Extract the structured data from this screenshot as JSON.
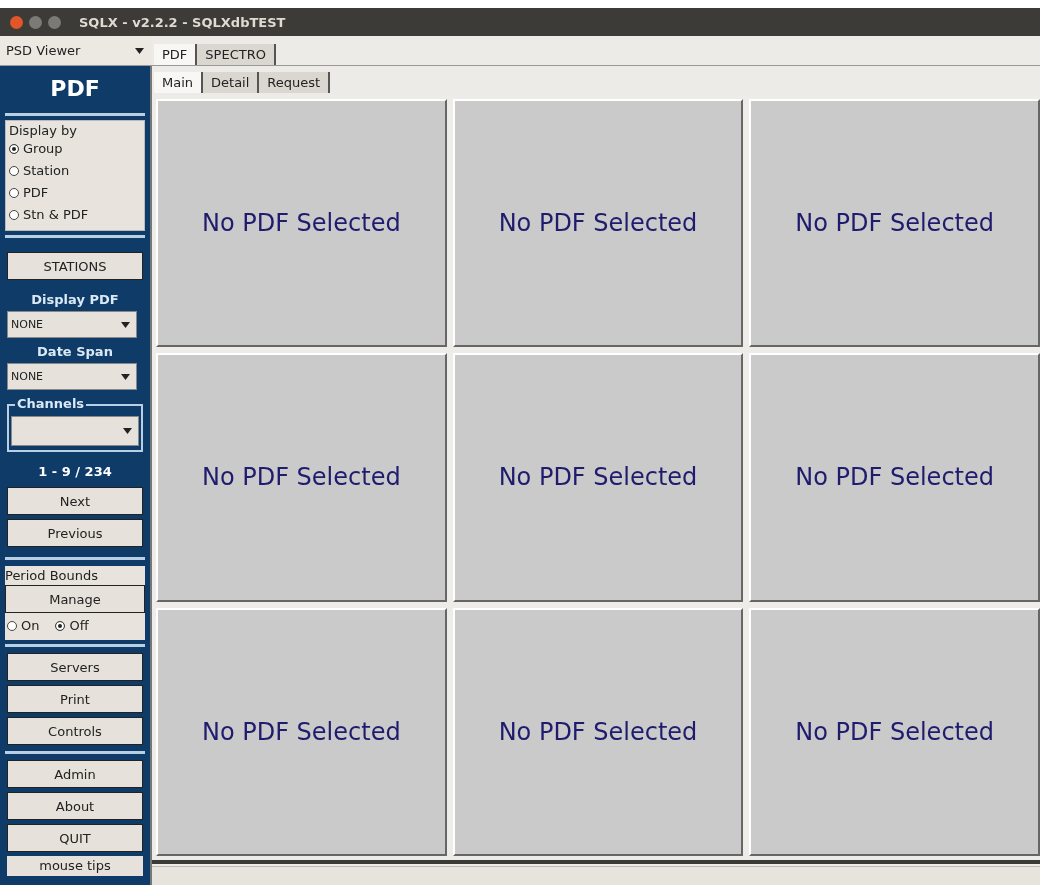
{
  "window": {
    "title": "SQLX - v2.2.2 - SQLXdbTEST"
  },
  "viewer_select": {
    "value": "PSD Viewer"
  },
  "tabs": [
    {
      "label": "PDF",
      "selected": true
    },
    {
      "label": "SPECTRO",
      "selected": false
    }
  ],
  "subtabs": [
    {
      "label": "Main",
      "selected": true
    },
    {
      "label": "Detail",
      "selected": false
    },
    {
      "label": "Request",
      "selected": false
    }
  ],
  "sidebar": {
    "heading": "PDF",
    "display_by": {
      "title": "Display by",
      "options": [
        {
          "label": "Group",
          "selected": true
        },
        {
          "label": "Station",
          "selected": false
        },
        {
          "label": "PDF",
          "selected": false
        },
        {
          "label": "Stn & PDF",
          "selected": false
        }
      ]
    },
    "stations_button": "STATIONS",
    "display_pdf": {
      "label": "Display PDF",
      "value": "NONE"
    },
    "date_span": {
      "label": "Date Span",
      "value": "NONE"
    },
    "channels": {
      "title": "Channels"
    },
    "page_range": "1 - 9 / 234",
    "nav_buttons": [
      "Next",
      "Previous"
    ],
    "period_bounds": {
      "title": "Period Bounds",
      "button": "Manage",
      "options": [
        {
          "label": "On",
          "selected": false
        },
        {
          "label": "Off",
          "selected": true
        }
      ]
    },
    "button_groups": [
      [
        "Servers",
        "Print",
        "Controls"
      ],
      [
        "Admin",
        "About",
        "QUIT"
      ]
    ],
    "mouse_tips": "mouse tips"
  },
  "panels": [
    {
      "text": "No PDF Selected"
    },
    {
      "text": "No PDF Selected"
    },
    {
      "text": "No PDF Selected"
    },
    {
      "text": "No PDF Selected"
    },
    {
      "text": "No PDF Selected"
    },
    {
      "text": "No PDF Selected"
    },
    {
      "text": "No PDF Selected"
    },
    {
      "text": "No PDF Selected"
    },
    {
      "text": "No PDF Selected"
    }
  ]
}
